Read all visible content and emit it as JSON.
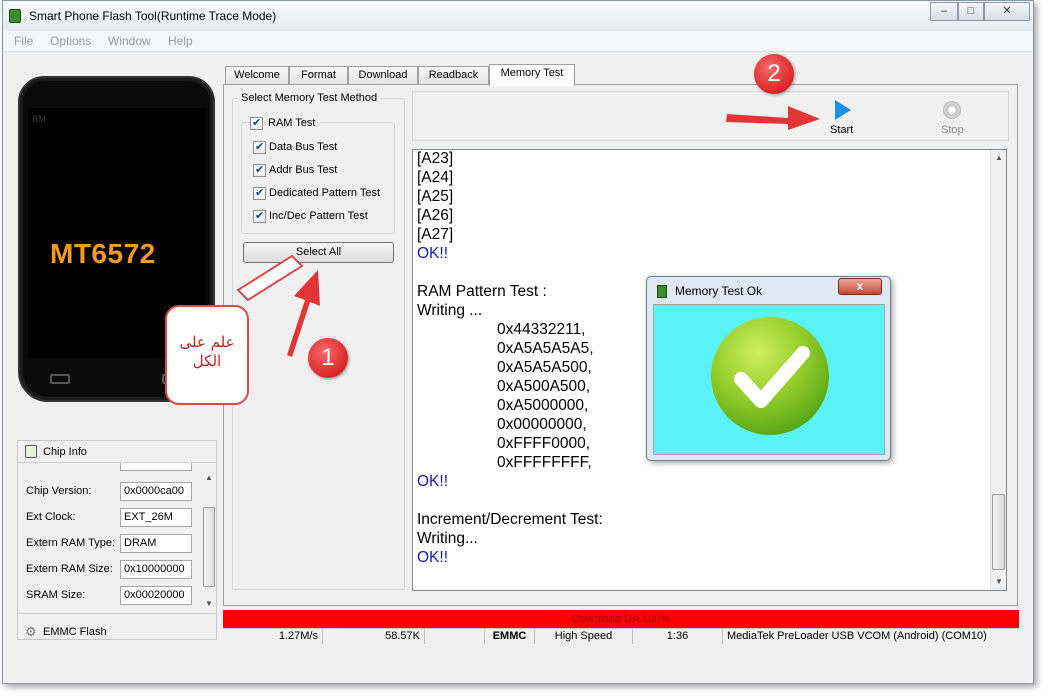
{
  "window": {
    "title": "Smart Phone Flash Tool(Runtime Trace Mode)",
    "controls": {
      "minimize": "–",
      "maximize": "□",
      "close": "✕"
    }
  },
  "menu": [
    "File",
    "Options",
    "Window",
    "Help"
  ],
  "phone": {
    "brand": "BM",
    "model": "MT6572"
  },
  "chip_info": {
    "title": "Chip Info",
    "fields": [
      {
        "label": "Chip Version:",
        "value": "0x0000ca00"
      },
      {
        "label": "Ext Clock:",
        "value": "EXT_26M"
      },
      {
        "label": "Extern RAM Type:",
        "value": "DRAM"
      },
      {
        "label": "Extern RAM Size:",
        "value": "0x10000000"
      },
      {
        "label": "SRAM Size:",
        "value": "0x00020000"
      }
    ],
    "emmc_label": "EMMC Flash"
  },
  "tabs": [
    "Welcome",
    "Format",
    "Download",
    "Readback",
    "Memory Test"
  ],
  "memory_test": {
    "group_title": "Select Memory Test Method",
    "ram_test": "RAM Test",
    "options": [
      "Data Bus Test",
      "Addr Bus Test",
      "Dedicated Pattern Test",
      "Inc/Dec Pattern Test"
    ],
    "select_all": "Select All"
  },
  "toolbar": {
    "start": "Start",
    "stop": "Stop"
  },
  "log": {
    "lines": [
      "[A23]",
      "[A24]",
      "[A25]",
      "[A26]",
      "[A27]",
      "OK!!",
      "",
      "RAM Pattern Test :",
      "Writing ...",
      "0x44332211,",
      "0xA5A5A5A5,",
      "0xA5A5A500,",
      "0xA500A500,",
      "0xA5000000,",
      "0x00000000,",
      "0xFFFF0000,",
      "0xFFFFFFFF,",
      "OK!!",
      "",
      "Increment/Decrement Test:",
      "Writing...",
      "OK!!"
    ]
  },
  "dialog": {
    "title": "Memory Test Ok",
    "close": "x"
  },
  "progress": {
    "text": "Download DA 100%",
    "percent": 100,
    "color": "#ff0000"
  },
  "status": {
    "speed": "1.27M/s",
    "size": "58.57K",
    "storage": "EMMC",
    "mode": "High Speed",
    "time": "1:36",
    "port": "MediaTek PreLoader USB VCOM (Android) (COM10)"
  },
  "annotations": {
    "callout": "علم على\nالكل",
    "step1": "1",
    "step2": "2"
  }
}
